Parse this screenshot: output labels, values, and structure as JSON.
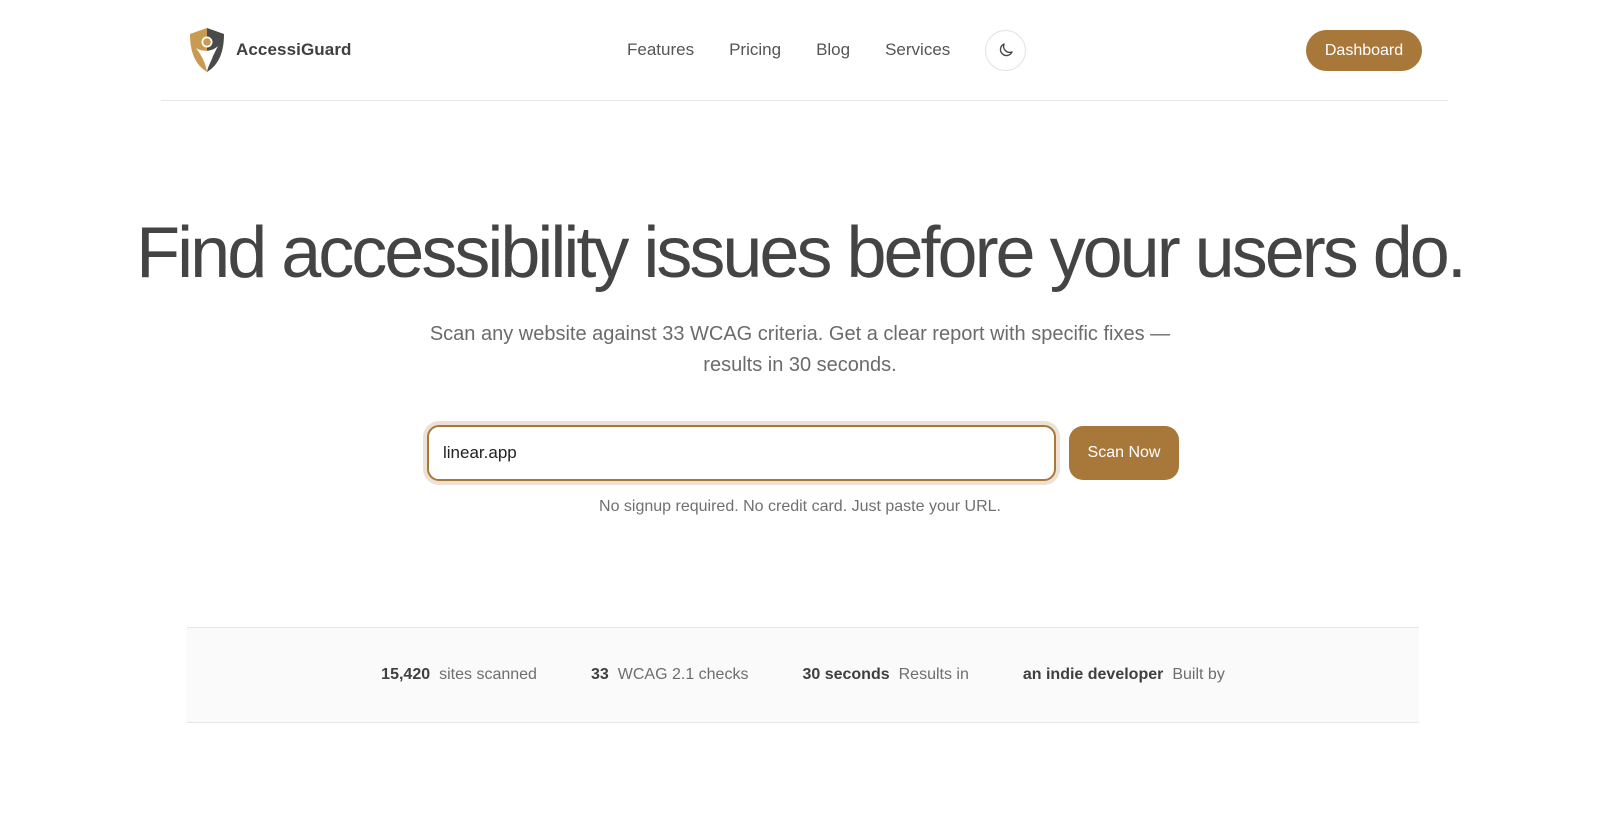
{
  "brand": {
    "name": "AccessiGuard",
    "accent_color": "#a8783a",
    "logo_icon": "shield-person-icon"
  },
  "nav": {
    "links": [
      {
        "label": "Features"
      },
      {
        "label": "Pricing"
      },
      {
        "label": "Blog"
      },
      {
        "label": "Services"
      }
    ],
    "theme_toggle_icon": "moon-icon",
    "dashboard_label": "Dashboard"
  },
  "hero": {
    "title": "Find accessibility issues before your users do.",
    "subtitle": "Scan any website against 33 WCAG criteria. Get a clear report with specific fixes — results in 30 seconds.",
    "url_input_value": "linear.app",
    "scan_button_label": "Scan Now",
    "note": "No signup required. No credit card. Just paste your URL."
  },
  "stats": [
    {
      "value": "15,420",
      "label": "sites scanned"
    },
    {
      "value": "33",
      "label": "WCAG 2.1 checks"
    },
    {
      "value": "30 seconds",
      "label": "Results in"
    },
    {
      "value": "an indie developer",
      "label": "Built by"
    }
  ]
}
